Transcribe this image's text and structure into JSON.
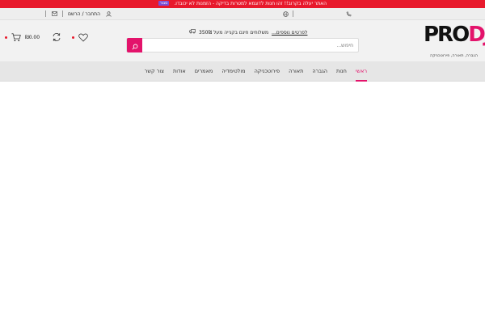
{
  "notice_bar": {
    "text": "האתר יעלה בקרוב!! זהו חנות לדוגמא למטרות בדיקה - הזמנות לא יכובדו.",
    "dismiss_label": "סגור"
  },
  "utility": {
    "login_label": "התחבר / הרשם",
    "icons": [
      "user-icon",
      "mail-icon",
      "globe-icon",
      "phone-icon"
    ]
  },
  "header": {
    "logo_main": "PRO",
    "logo_accent": "DJ",
    "logo_tagline": "הגברה, תאורה, פירוטכניקה",
    "search_placeholder": "חיפוש...",
    "shipping_text": "משלוחים חינם בקנייה מעל 350₪",
    "shipping_link": "לפרטים נוספים...",
    "cart_total": "₪0.00"
  },
  "nav": {
    "items": [
      {
        "label": "ראשי",
        "active": true
      },
      {
        "label": "חנות",
        "active": false
      },
      {
        "label": "הגברה",
        "active": false
      },
      {
        "label": "תאורה",
        "active": false
      },
      {
        "label": "פירוטכניקה",
        "active": false
      },
      {
        "label": "מולטימדיה",
        "active": false
      },
      {
        "label": "מאמרים",
        "active": false
      },
      {
        "label": "אודות",
        "active": false
      },
      {
        "label": "צור קשר",
        "active": false
      }
    ]
  },
  "colors": {
    "brand_pink": "#e3136b",
    "notice_red": "#e8192c"
  }
}
